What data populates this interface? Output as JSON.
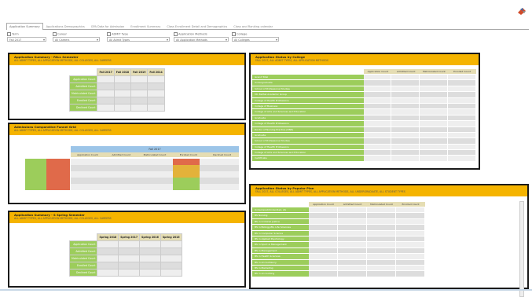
{
  "tabs": [
    {
      "label": "Application Summary",
      "active": true
    },
    {
      "label": "Applications Demographics",
      "active": false
    },
    {
      "label": "GPA Data for Admission",
      "active": false
    },
    {
      "label": "Enrollment Summary",
      "active": false
    },
    {
      "label": "Class Enrollment Detail and Demographics",
      "active": false
    },
    {
      "label": "Class and Ranking calendar",
      "active": false
    }
  ],
  "filters": [
    {
      "label": "Term",
      "value": "Fall 2017"
    },
    {
      "label": "Career",
      "value": "All Careers"
    },
    {
      "label": "ADMIT Type",
      "value": "All Admit Types"
    },
    {
      "label": "Application Methods",
      "value": "All Application Methods"
    },
    {
      "label": "College",
      "value": "All Colleges"
    }
  ],
  "panels": {
    "fall": {
      "title": "Application Summary - FALL Semester",
      "subtitle": "ALL ADMIT TYPES, ALL APPLICATION METHODS, ALL COLLEGES, ALL CAREERS",
      "columns": [
        "Fall 2017",
        "Fall 2018",
        "Fall 2019",
        "Fall 2014"
      ],
      "rows": [
        "Application Count",
        "Admitted Count",
        "Matriculated Count",
        "Enrolled Count",
        "Declined Count"
      ]
    },
    "admissions": {
      "title": "Admissions Comparative Funnel Grid",
      "subtitle": "ALL ADMIT TYPES, ALL APPLICATION METHODS, ALL COLLEGES, ALL CAREERS",
      "group_header": "Fall 2017",
      "columns": [
        "Application Count",
        "Admitted Count",
        "Matriculated Count",
        "Enrolled Count",
        "Declined Count"
      ]
    },
    "spring": {
      "title": "Application Summary - S Spring Semester",
      "subtitle": "ALL ADMIT TYPES, ALL APPLICATION METHODS, ALL COLLEGES, ALL CAREERS",
      "columns": [
        "Spring 2018",
        "Spring 2017",
        "Spring 2016",
        "Spring 2015"
      ],
      "rows": [
        "Application Count",
        "Admitted Count",
        "Matriculated Count",
        "Enrolled Count",
        "Declined Count"
      ]
    },
    "college": {
      "title": "Application Status by College",
      "subtitle": "FALL 2017, ALL ADMIT TYPES, ALL APPLICATION METHODS",
      "columns": [
        "Application Count",
        "Admitted Count",
        "Matriculated Count",
        "Enrolled Count"
      ],
      "rows": [
        "Grand Total",
        "Undergraduate",
        "School of Professional Studies",
        "Mt. Bethel Academic Group",
        "College of Health Professions",
        "College of Business",
        "College of Arts and Sciences and Education",
        "Graduate",
        "College of Health Professions",
        "Doctor of Nursing Practice (DNP)",
        "Graduate",
        "School of Professional Studies",
        "College of Health Professions",
        "College of Arts and Sciences and Education",
        "Certificate"
      ]
    },
    "major": {
      "title": "Application Status by Popular Plan",
      "subtitle": "FALL 2017, ALL COLLEGES, ALL ADMIT TYPES, ALL APPLICATION METHODS, ALL UNDERGRADUATE, ALL STUDENT TYPES",
      "columns": [
        "Application Count",
        "Admitted Count",
        "Matriculated Count",
        "Enrolled Count"
      ],
      "rows": [
        "Undeclared/Undecided, AS",
        "BS Nursing",
        "BS in Criminal Justice",
        "BS in Biology-BS, Life Sciences",
        "BS in Computer Science",
        "BS in Applied Psychology",
        "BS in Sport & Management",
        "BS in Management",
        "BS in Health Sciences",
        "BS in Accountancy",
        "BS in Marketing",
        "BS in Accounting"
      ]
    }
  }
}
